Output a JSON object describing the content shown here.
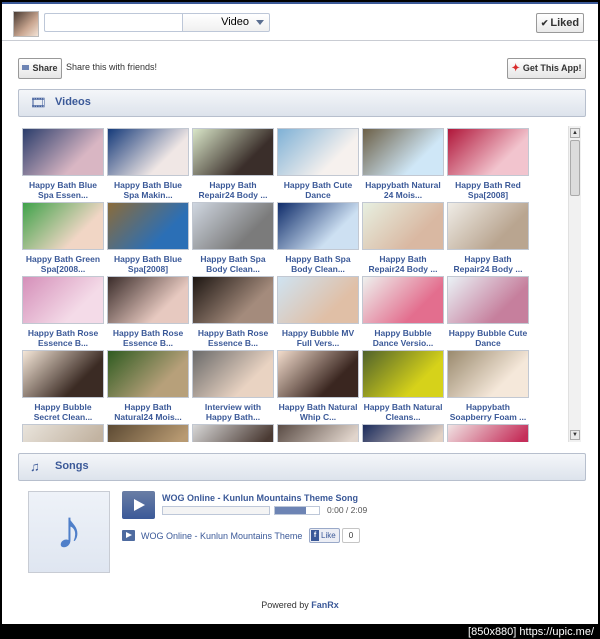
{
  "header": {
    "search_placeholder": "",
    "select_value": "Video",
    "liked_label": "Liked"
  },
  "share": {
    "button_label": "Share",
    "text": "Share this with friends!",
    "get_app_label": "Get This App!"
  },
  "videos": {
    "title": "Videos",
    "items": [
      {
        "caption": "Happy Bath Blue Spa Essen...",
        "colors": [
          "#2a3d6b",
          "#d9b6c3"
        ]
      },
      {
        "caption": "Happy Bath Blue Spa Makin...",
        "colors": [
          "#153a7a",
          "#f0e7e5"
        ]
      },
      {
        "caption": "Happy Bath Repair24 Body ...",
        "colors": [
          "#d9e6c8",
          "#3a2e2a"
        ]
      },
      {
        "caption": "Happy Bath Cute Dance",
        "colors": [
          "#7fb1d6",
          "#f6f1ee"
        ]
      },
      {
        "caption": "Happybath Natural 24 Mois...",
        "colors": [
          "#6c6047",
          "#cfe7f7"
        ]
      },
      {
        "caption": "Happy Bath Red Spa[2008]",
        "colors": [
          "#b0163a",
          "#f2c4ce"
        ]
      },
      {
        "caption": "Happy Bath Green Spa[2008...",
        "colors": [
          "#3fa24a",
          "#f1d6c5"
        ]
      },
      {
        "caption": "Happy Bath Blue Spa[2008]",
        "colors": [
          "#8a6b3a",
          "#2b6fb6"
        ]
      },
      {
        "caption": "Happy Bath Spa Body Clean...",
        "colors": [
          "#cfd6e0",
          "#7b7b7b"
        ]
      },
      {
        "caption": "Happy Bath Spa Body Clean...",
        "colors": [
          "#0f2c6a",
          "#cde0f2"
        ]
      },
      {
        "caption": "Happy Bath Repair24 Body ...",
        "colors": [
          "#e7efe0",
          "#d9b8a2"
        ]
      },
      {
        "caption": "Happy Bath Repair24 Body ...",
        "colors": [
          "#efece6",
          "#b9a590"
        ]
      },
      {
        "caption": "Happy Bath Rose Essence B...",
        "colors": [
          "#d58fb9",
          "#f4dbe8"
        ]
      },
      {
        "caption": "Happy Bath Rose Essence B...",
        "colors": [
          "#3a2c2a",
          "#e7c9c0"
        ]
      },
      {
        "caption": "Happy Bath Rose Essence B...",
        "colors": [
          "#1d1612",
          "#a48b7c"
        ]
      },
      {
        "caption": "Happy Bubble MV Full Vers...",
        "colors": [
          "#cfe3f1",
          "#e0bfa6"
        ]
      },
      {
        "caption": "Happy Bubble Dance Versio...",
        "colors": [
          "#eef1ee",
          "#e36e8e"
        ]
      },
      {
        "caption": "Happy Bubble Cute Dance",
        "colors": [
          "#eaf2f6",
          "#c67f9d"
        ]
      },
      {
        "caption": "Happy Bubble Secret Clean...",
        "colors": [
          "#f5e7d8",
          "#3b2b24"
        ]
      },
      {
        "caption": "Happy Bath Natural24 Mois...",
        "colors": [
          "#2f5b21",
          "#b7a07a"
        ]
      },
      {
        "caption": "Interview with Happy Bath...",
        "colors": [
          "#6a6a6a",
          "#e9d3c2"
        ]
      },
      {
        "caption": "Happy Bath Natural Whip C...",
        "colors": [
          "#f2dccc",
          "#3a2620"
        ]
      },
      {
        "caption": "Happy Bath Natural Cleans...",
        "colors": [
          "#50622b",
          "#d6d21a"
        ]
      },
      {
        "caption": "Happybath Soapberry Foam ...",
        "colors": [
          "#9a8a6e",
          "#f5e8da"
        ]
      },
      {
        "caption": "",
        "colors": [
          "#e9e4dc",
          "#c2b3a1"
        ]
      },
      {
        "caption": "",
        "colors": [
          "#5c4a33",
          "#b89a72"
        ]
      },
      {
        "caption": "",
        "colors": [
          "#d7d7d7",
          "#4a3a33"
        ]
      },
      {
        "caption": "",
        "colors": [
          "#5a4c45",
          "#e1d5cc"
        ]
      },
      {
        "caption": "",
        "colors": [
          "#1a2b5c",
          "#e3d2c5"
        ]
      },
      {
        "caption": "",
        "colors": [
          "#f0e3e3",
          "#c52f5a"
        ]
      }
    ]
  },
  "songs": {
    "title": "Songs",
    "now_playing": "WOG Online - Kunlun Mountains Theme Song",
    "time": "0:00 / 2:09",
    "volume": 0.7,
    "tracks": [
      {
        "title": "WOG Online - Kunlun Mountains Theme"
      }
    ],
    "fb_like_label": "Like",
    "like_count": "0"
  },
  "footer": {
    "powered_by": "Powered by",
    "brand": "FanRx",
    "watermark": "[850x880] https://upic.me/"
  },
  "colors": {
    "accent": "#3b5998",
    "link": "#3b5998"
  }
}
